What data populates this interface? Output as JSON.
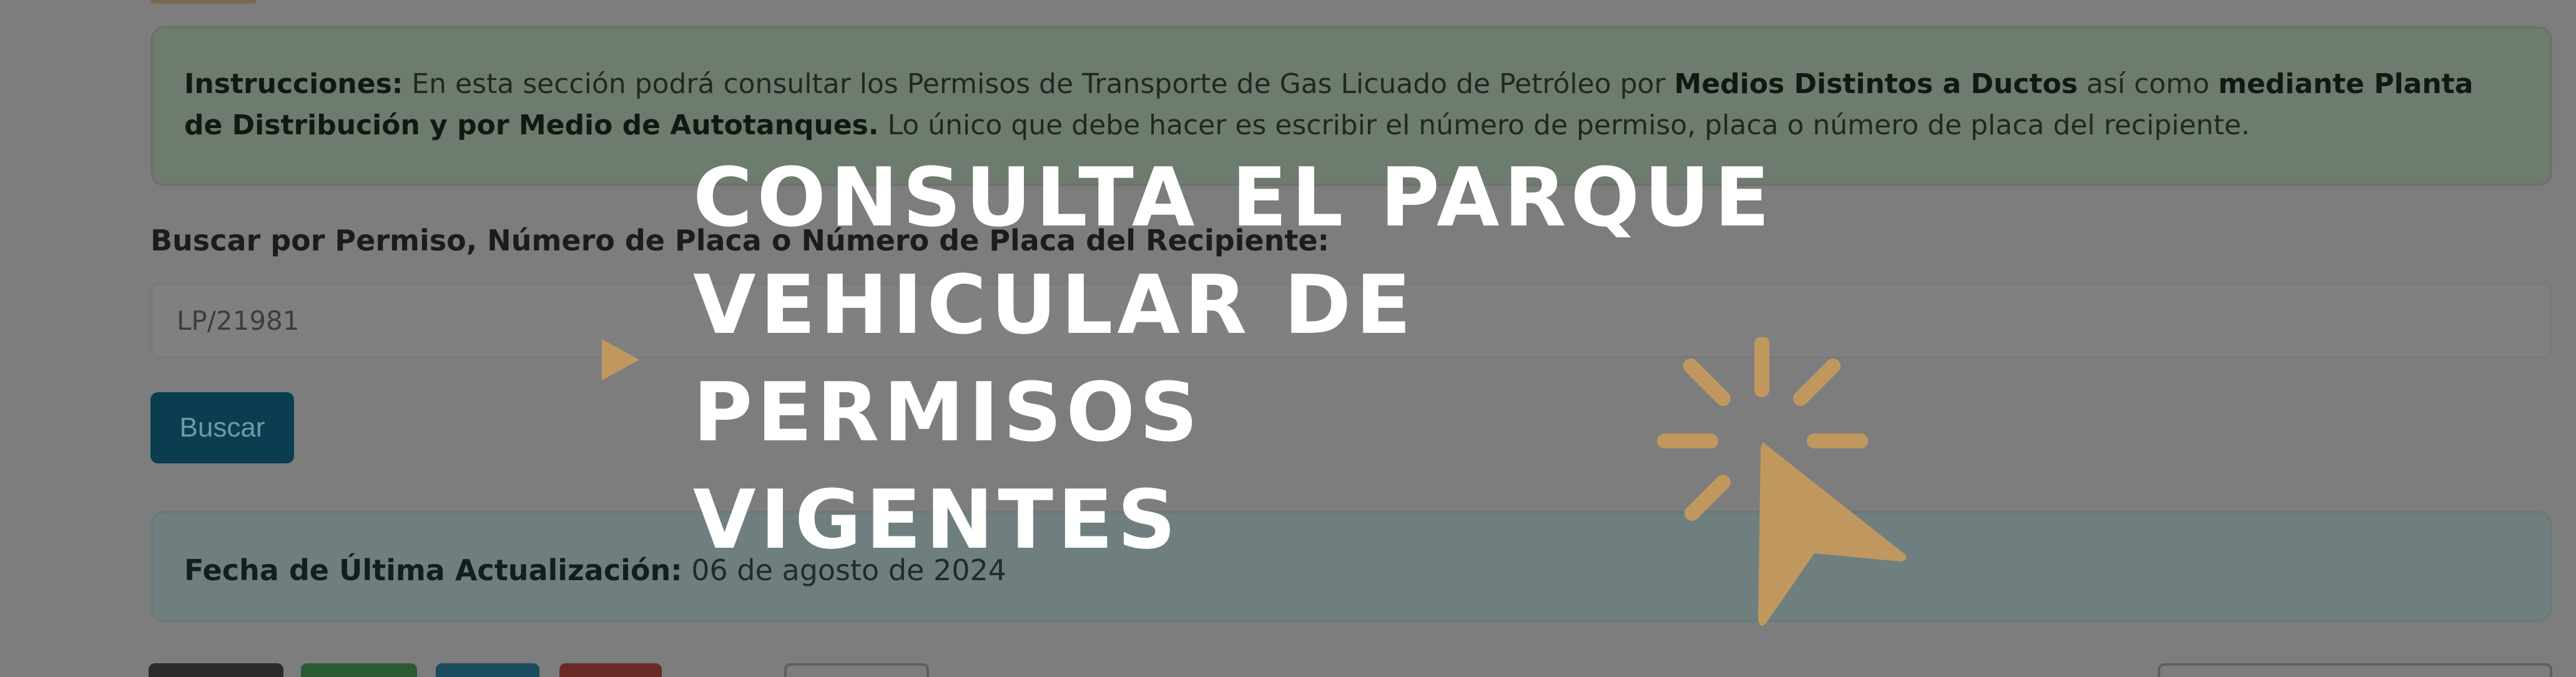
{
  "instructions": {
    "label": "Instrucciones:",
    "text1": " En esta sección podrá consultar los Permisos de Transporte de Gas Licuado de Petróleo por ",
    "bold1": "Medios Distintos a Ductos",
    "text2": " así como ",
    "bold2": "mediante Planta de Distribución y por Medio de Autotanques.",
    "text3": " Lo único que debe hacer es escribir el número de permiso, placa o número de placa del recipiente."
  },
  "search": {
    "label": "Buscar por Permiso, Número de Placa o Número de Placa del Recipiente:",
    "value": "LP/21981",
    "button_label": "Buscar"
  },
  "update": {
    "label": "Fecha de Última Actualización:",
    "date": " 06 de agosto de 2024"
  },
  "overlay": {
    "headline_line1": "CONSULTA EL PARQUE",
    "headline_line2": "VEHICULAR DE PERMISOS",
    "headline_line3": "VIGENTES",
    "accent_color": "#c0985f",
    "icons": [
      "play-triangle-icon",
      "cursor-click-icon"
    ]
  },
  "colors": {
    "button_bg": "#0a3d4f",
    "instructions_bg": "#6e7b6f",
    "update_bg": "#6f7f80"
  }
}
